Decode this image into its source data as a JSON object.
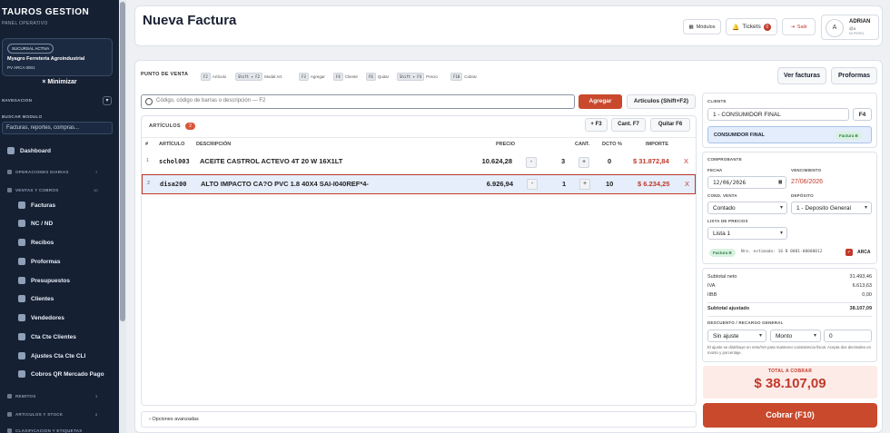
{
  "sidebar": {
    "brand": "TAUROS GESTION",
    "brand_sub": "PANEL OPERATIVO",
    "branch_pill": "SUCURSAL ACTIVA",
    "branch_name": "Myagro Ferreteria Agroindustrial",
    "branch_pv": "PV ARCA 0001",
    "minimize": "Minimizar",
    "nav_label": "NAVEGACION",
    "search_label": "BUSCAR MODULO",
    "search_value": "Facturas, reportes, compras...",
    "dashboard": "Dashboard",
    "group_ops": "OPERACIONES DIARIAS",
    "group_ops_count": "7",
    "group_sales": "VENTAS Y COBROS",
    "group_sales_count": "10",
    "items": [
      "Facturas",
      "NC / ND",
      "Recibos",
      "Proformas",
      "Presupuestos",
      "Clientes",
      "Vendedores",
      "Cta Cte Clientes",
      "Ajustes Cta Cte CLI",
      "Cobros QR Mercado Pago"
    ],
    "group_remitos": "REMITOS",
    "group_remitos_count": "3",
    "group_stock": "ARTICULOS Y STOCK",
    "group_stock_count": "8",
    "group_clas": "CLASIFICACION Y ETIQUETAS"
  },
  "header": {
    "title": "Nueva Factura",
    "modulos": "Módulos",
    "tickets": "Tickets",
    "tickets_count": "0",
    "salir": "Salir",
    "user_initial": "A",
    "user_name": "ADRIAN",
    "user_sub": "@a",
    "user_profile": "MI PERFIL"
  },
  "pos": {
    "label": "PUNTO DE VENTA",
    "shortcuts": [
      {
        "key": "F2",
        "label": "Artículo"
      },
      {
        "key": "Shift + F2",
        "label": "Modal Art."
      },
      {
        "key": "F3",
        "label": "Agregar"
      },
      {
        "key": "F4",
        "label": "Cliente"
      },
      {
        "key": "F6",
        "label": "Quitar"
      },
      {
        "key": "Shift + F4",
        "label": "Precio"
      },
      {
        "key": "F10",
        "label": "Cobrar"
      }
    ],
    "ver_facturas": "Ver facturas",
    "proformas": "Proformas"
  },
  "search": {
    "placeholder": "Código, código de barras o descripción — F2",
    "agregar": "Agregar",
    "articulos": "Articulos (Shift+F2)"
  },
  "articles": {
    "label": "ARTÍCULOS",
    "count": "2",
    "btn_f3": "+ F3",
    "btn_cant": "Cant. F7",
    "btn_quitar": "Quitar F6",
    "columns": [
      "#",
      "ARTÍCULO",
      "DESCRIPCIÓN",
      "PRECIO",
      "CANT.",
      "DCTO %",
      "IMPORTE"
    ],
    "rows": [
      {
        "n": "1",
        "code": "schol003",
        "desc": "ACEITE CASTROL ACTEVO 4T 20 W 16X1LT",
        "price": "10.624,28",
        "qty": "3",
        "dcto": "0",
        "importe": "$ 31.872,84"
      },
      {
        "n": "2",
        "code": "disa200",
        "desc": "ALTO IMPACTO CA?O PVC  1.8 40X4 SAI-I040REF*4-",
        "price": "6.926,94",
        "qty": "1",
        "dcto": "10",
        "importe": "$ 6.234,25"
      }
    ],
    "minus": "-",
    "plus": "+",
    "remove": "X"
  },
  "options": "Opciones avanzadas",
  "right": {
    "cliente_label": "CLIENTE",
    "cliente_value": "1 - CONSUMIDOR FINAL",
    "f4": "F4",
    "consumidor": "CONSUMIDOR FINAL",
    "factura_tag": "Factura B",
    "comprobante_label": "COMPROBANTE",
    "fecha_label": "FECHA",
    "fecha_value": "12/06/2026",
    "venc_label": "VENCIMIENTO",
    "venc_value": "27/06/2026",
    "cond_label": "COND. VENTA",
    "cond_value": "Contado",
    "deposito_label": "DEPÓSITO",
    "deposito_value": "1 - Deposito General",
    "lista_label": "LISTA DE PRECIOS",
    "lista_value": "Lista 1",
    "nro_tag": "Factura B",
    "nro_text": "Nro. estimado: 16 B 0001-00000012",
    "arca": "ARCA",
    "check": "✓",
    "subtotal_label": "Subtotal neto",
    "subtotal_value": "31.493,46",
    "iva_label": "IVA",
    "iva_value": "6.613,63",
    "iibb_label": "IIBB",
    "iibb_value": "0,00",
    "ajustado_label": "Subtotal ajustado",
    "ajustado_value": "38.107,09",
    "desc_label": "DESCUENTO / RECARGO GENERAL",
    "ajuste_value": "Sin ajuste",
    "monto_value": "Monto",
    "amount_value": "0",
    "note": "El ajuste se distribuye en neto/IVA para mantener consistencia fiscal. Acepta dos decimales en monto y porcentaje.",
    "total_label": "TOTAL A COBRAR",
    "total_value": "$ 38.107,09",
    "cobrar": "Cobrar (F10)"
  },
  "colors": {
    "accent": "#c9492c",
    "sidebar": "#152033",
    "danger": "#c0392b"
  }
}
